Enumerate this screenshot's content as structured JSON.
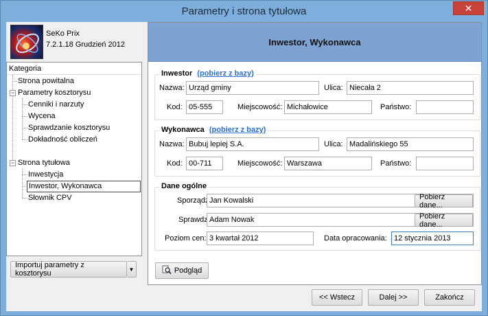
{
  "window": {
    "title": "Parametry i strona tytułowa",
    "close_glyph": "✕"
  },
  "brand": {
    "name": "SeKo Prix",
    "version": "7.2.1.18 Grudzień 2012"
  },
  "tree": {
    "header": "Kategoria",
    "items": [
      {
        "label": "Strona powitalna"
      },
      {
        "label": "Parametry kosztorysu"
      },
      {
        "label": "Cenniki i narzuty"
      },
      {
        "label": "Wycena"
      },
      {
        "label": "Sprawdzanie kosztorysu"
      },
      {
        "label": "Dokładność obliczeń"
      },
      {
        "label": "Strona tytułowa"
      },
      {
        "label": "Inwestycja"
      },
      {
        "label": "Inwestor, Wykonawca"
      },
      {
        "label": "Słownik CPV"
      }
    ],
    "expander_glyph": "−"
  },
  "import": {
    "label": "Importuj parametry z kosztorysu",
    "arrow": "▼"
  },
  "section": {
    "title": "Inwestor, Wykonawca"
  },
  "inwestor": {
    "legend": "Inwestor",
    "link": "(pobierz z bazy)",
    "nazwa_label": "Nazwa:",
    "nazwa": "Urząd gminy",
    "ulica_label": "Ulica:",
    "ulica": "Niecała 2",
    "kod_label": "Kod:",
    "kod": "05-555",
    "miejscowosc_label": "Miejscowość:",
    "miejscowosc": "Michałowice",
    "panstwo_label": "Państwo:",
    "panstwo": ""
  },
  "wykonawca": {
    "legend": "Wykonawca",
    "link": "(pobierz z bazy)",
    "nazwa_label": "Nazwa:",
    "nazwa": "Bubuj lepiej S.A.",
    "ulica_label": "Ulica:",
    "ulica": "Madalińskiego 55",
    "kod_label": "Kod:",
    "kod": "00-711",
    "miejscowosc_label": "Miejscowość:",
    "miejscowosc": "Warszawa",
    "panstwo_label": "Państwo:",
    "panstwo": ""
  },
  "ogolne": {
    "legend": "Dane ogólne",
    "sporzadzil_label": "Sporządził:",
    "sporzadzil": "Jan Kowalski",
    "sprawdzil_label": "Sprawdził:",
    "sprawdzil": "Adam Nowak",
    "pobierz_label": "Pobierz dane...",
    "poziom_label": "Poziom cen:",
    "poziom": "3 kwartał 2012",
    "data_label": "Data opracowania:",
    "data": "12 stycznia 2013"
  },
  "preview": {
    "label": "Podgląd"
  },
  "nav": {
    "back": "<< Wstecz",
    "next": "Dalej >>",
    "finish": "Zakończ"
  }
}
